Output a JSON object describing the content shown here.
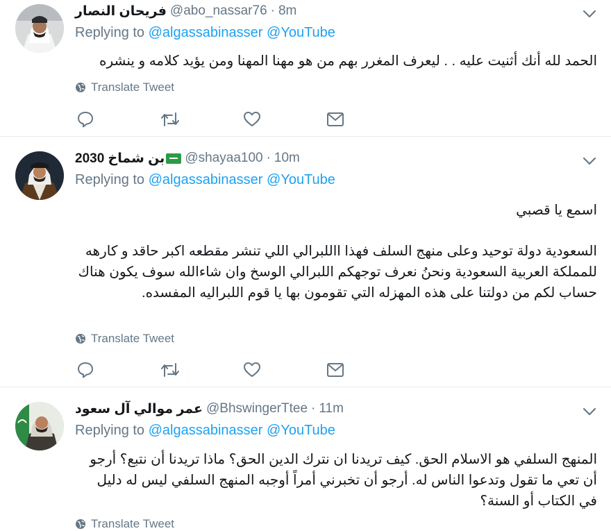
{
  "reply_prefix": "Replying to",
  "translate_label": "Translate Tweet",
  "colors": {
    "link": "#1da1f2",
    "muted": "#657786",
    "text": "#14171a",
    "divider": "#e6ecf0"
  },
  "tweets": [
    {
      "name": "فريحان النصار",
      "handle": "@abo_nassar76",
      "separator": "·",
      "time": "8m",
      "mentions": [
        "@algassabinasser",
        "@YouTube"
      ],
      "text": "الحمد لله أنك أثنيت عليه . . ليعرف المغرر بهم من هو مهنا المهنا ومن يؤيد كلامه و ينشره"
    },
    {
      "name": "بن شماخ 2030",
      "badge_icon": "saudi-flag-icon",
      "handle": "@shayaa100",
      "separator": "·",
      "time": "10m",
      "mentions": [
        "@algassabinasser",
        "@YouTube"
      ],
      "text": "اسمع يا قصبي",
      "text2": "السعودية دولة توحيد وعلى منهج السلف فهذا االلبرالي اللي تنشر مقطعه اكبر حاقد و كارهه للمملكة العربية السعودية ونحنُ نعرف توجهكم اللبرالي الوسخ وان شاءالله سوف يكون هناك حساب لكم من دولتنا على هذه المهزله التي تقومون بها يا قوم اللبراليه المفسده."
    },
    {
      "name": "عمر موالي آل سعود",
      "handle": "@BhswingerTtee",
      "separator": "·",
      "time": "11m",
      "mentions": [
        "@algassabinasser",
        "@YouTube"
      ],
      "text": "المنهج السلفي هو الاسلام الحق. كيف تريدنا ان نترك الدين الحق؟ ماذا تريدنا أن نتبع؟ أرجو أن تعي ما تقول وتدعوا الناس له. أرجو أن تخبرني أمراً أوجبه المنهج السلفي ليس له دليل في الكتاب أو السنة؟"
    }
  ]
}
